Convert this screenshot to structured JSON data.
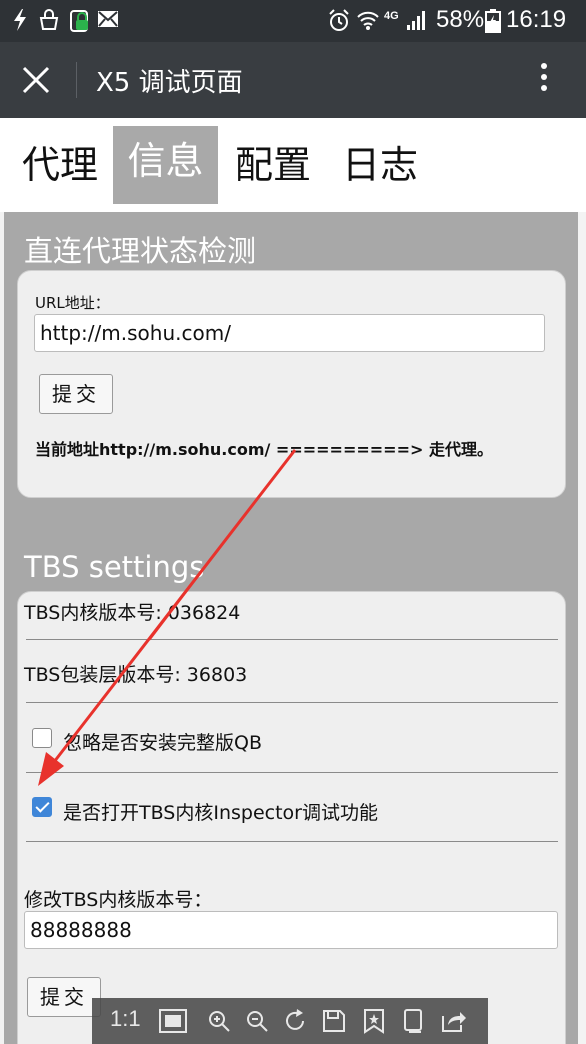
{
  "status_bar": {
    "network_type": "4G",
    "battery_percent": "58%",
    "time": "16:19"
  },
  "title_bar": {
    "title": "X5 调试页面",
    "icons": [
      "close-icon",
      "more-vertical-icon"
    ]
  },
  "tabs": [
    {
      "label": "代理",
      "active": false
    },
    {
      "label": "信息",
      "active": true
    },
    {
      "label": "配置",
      "active": false
    },
    {
      "label": "日志",
      "active": false
    }
  ],
  "proxy_section": {
    "heading": "直连代理状态检测",
    "url_label": "URL地址：",
    "url_value": "http://m.sohu.com/",
    "submit_label": "提交",
    "result": "当前地址http://m.sohu.com/ ==========> 走代理。"
  },
  "tbs_section": {
    "heading": "TBS settings",
    "core_version": "TBS内核版本号: 036824",
    "wrapper_version": "TBS包装层版本号: 36803",
    "option_ignore_qb": {
      "label": "忽略是否安装完整版QB",
      "checked": false
    },
    "option_inspector": {
      "label": "是否打开TBS内核Inspector调试功能",
      "checked": true
    },
    "modify_label": "修改TBS内核版本号：",
    "modify_value": "88888888",
    "submit_label": "提交"
  },
  "viewer_toolbar": {
    "zoom_label": "1:1",
    "icons": [
      "fit-screen-icon",
      "zoom-in-icon",
      "zoom-out-icon",
      "rotate-icon",
      "save-icon",
      "bookmark-icon",
      "copy-icon",
      "share-icon"
    ]
  },
  "colors": {
    "status_bar_bg": "#2e3236",
    "title_bar_bg": "#393d41",
    "content_bg": "#a8a8a8",
    "active_tab_bg": "#a9a9a9",
    "checkbox_checked": "#3f86d8",
    "annotation_arrow": "#e8322c"
  }
}
